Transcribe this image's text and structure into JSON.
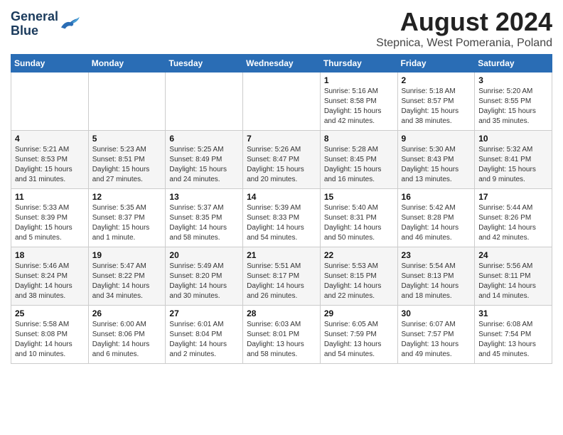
{
  "header": {
    "logo_line1": "General",
    "logo_line2": "Blue",
    "month_title": "August 2024",
    "location": "Stepnica, West Pomerania, Poland"
  },
  "weekdays": [
    "Sunday",
    "Monday",
    "Tuesday",
    "Wednesday",
    "Thursday",
    "Friday",
    "Saturday"
  ],
  "weeks": [
    [
      {
        "day": "",
        "info": ""
      },
      {
        "day": "",
        "info": ""
      },
      {
        "day": "",
        "info": ""
      },
      {
        "day": "",
        "info": ""
      },
      {
        "day": "1",
        "info": "Sunrise: 5:16 AM\nSunset: 8:58 PM\nDaylight: 15 hours\nand 42 minutes."
      },
      {
        "day": "2",
        "info": "Sunrise: 5:18 AM\nSunset: 8:57 PM\nDaylight: 15 hours\nand 38 minutes."
      },
      {
        "day": "3",
        "info": "Sunrise: 5:20 AM\nSunset: 8:55 PM\nDaylight: 15 hours\nand 35 minutes."
      }
    ],
    [
      {
        "day": "4",
        "info": "Sunrise: 5:21 AM\nSunset: 8:53 PM\nDaylight: 15 hours\nand 31 minutes."
      },
      {
        "day": "5",
        "info": "Sunrise: 5:23 AM\nSunset: 8:51 PM\nDaylight: 15 hours\nand 27 minutes."
      },
      {
        "day": "6",
        "info": "Sunrise: 5:25 AM\nSunset: 8:49 PM\nDaylight: 15 hours\nand 24 minutes."
      },
      {
        "day": "7",
        "info": "Sunrise: 5:26 AM\nSunset: 8:47 PM\nDaylight: 15 hours\nand 20 minutes."
      },
      {
        "day": "8",
        "info": "Sunrise: 5:28 AM\nSunset: 8:45 PM\nDaylight: 15 hours\nand 16 minutes."
      },
      {
        "day": "9",
        "info": "Sunrise: 5:30 AM\nSunset: 8:43 PM\nDaylight: 15 hours\nand 13 minutes."
      },
      {
        "day": "10",
        "info": "Sunrise: 5:32 AM\nSunset: 8:41 PM\nDaylight: 15 hours\nand 9 minutes."
      }
    ],
    [
      {
        "day": "11",
        "info": "Sunrise: 5:33 AM\nSunset: 8:39 PM\nDaylight: 15 hours\nand 5 minutes."
      },
      {
        "day": "12",
        "info": "Sunrise: 5:35 AM\nSunset: 8:37 PM\nDaylight: 15 hours\nand 1 minute."
      },
      {
        "day": "13",
        "info": "Sunrise: 5:37 AM\nSunset: 8:35 PM\nDaylight: 14 hours\nand 58 minutes."
      },
      {
        "day": "14",
        "info": "Sunrise: 5:39 AM\nSunset: 8:33 PM\nDaylight: 14 hours\nand 54 minutes."
      },
      {
        "day": "15",
        "info": "Sunrise: 5:40 AM\nSunset: 8:31 PM\nDaylight: 14 hours\nand 50 minutes."
      },
      {
        "day": "16",
        "info": "Sunrise: 5:42 AM\nSunset: 8:28 PM\nDaylight: 14 hours\nand 46 minutes."
      },
      {
        "day": "17",
        "info": "Sunrise: 5:44 AM\nSunset: 8:26 PM\nDaylight: 14 hours\nand 42 minutes."
      }
    ],
    [
      {
        "day": "18",
        "info": "Sunrise: 5:46 AM\nSunset: 8:24 PM\nDaylight: 14 hours\nand 38 minutes."
      },
      {
        "day": "19",
        "info": "Sunrise: 5:47 AM\nSunset: 8:22 PM\nDaylight: 14 hours\nand 34 minutes."
      },
      {
        "day": "20",
        "info": "Sunrise: 5:49 AM\nSunset: 8:20 PM\nDaylight: 14 hours\nand 30 minutes."
      },
      {
        "day": "21",
        "info": "Sunrise: 5:51 AM\nSunset: 8:17 PM\nDaylight: 14 hours\nand 26 minutes."
      },
      {
        "day": "22",
        "info": "Sunrise: 5:53 AM\nSunset: 8:15 PM\nDaylight: 14 hours\nand 22 minutes."
      },
      {
        "day": "23",
        "info": "Sunrise: 5:54 AM\nSunset: 8:13 PM\nDaylight: 14 hours\nand 18 minutes."
      },
      {
        "day": "24",
        "info": "Sunrise: 5:56 AM\nSunset: 8:11 PM\nDaylight: 14 hours\nand 14 minutes."
      }
    ],
    [
      {
        "day": "25",
        "info": "Sunrise: 5:58 AM\nSunset: 8:08 PM\nDaylight: 14 hours\nand 10 minutes."
      },
      {
        "day": "26",
        "info": "Sunrise: 6:00 AM\nSunset: 8:06 PM\nDaylight: 14 hours\nand 6 minutes."
      },
      {
        "day": "27",
        "info": "Sunrise: 6:01 AM\nSunset: 8:04 PM\nDaylight: 14 hours\nand 2 minutes."
      },
      {
        "day": "28",
        "info": "Sunrise: 6:03 AM\nSunset: 8:01 PM\nDaylight: 13 hours\nand 58 minutes."
      },
      {
        "day": "29",
        "info": "Sunrise: 6:05 AM\nSunset: 7:59 PM\nDaylight: 13 hours\nand 54 minutes."
      },
      {
        "day": "30",
        "info": "Sunrise: 6:07 AM\nSunset: 7:57 PM\nDaylight: 13 hours\nand 49 minutes."
      },
      {
        "day": "31",
        "info": "Sunrise: 6:08 AM\nSunset: 7:54 PM\nDaylight: 13 hours\nand 45 minutes."
      }
    ]
  ]
}
